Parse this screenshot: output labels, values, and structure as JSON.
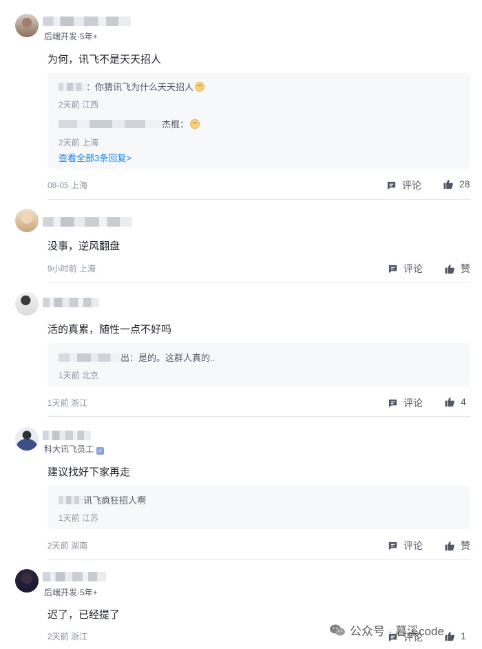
{
  "actions": {
    "comment_label": "评论",
    "like_label": "赞"
  },
  "comments": [
    {
      "badge": "后端开发·5年+",
      "content": "为何，讯飞不是天天招人",
      "replies": [
        {
          "author_tail": "：",
          "text": "你猜讯飞为什么天天招人",
          "meta": "2天前 江西"
        },
        {
          "author_tail": "杰棍：",
          "text": "",
          "meta": "2天前 上海"
        }
      ],
      "view_all": "查看全部3条回复>",
      "meta": "08-05 上海",
      "like_count": "28"
    },
    {
      "badge": "",
      "content": "没事，逆风翻盘",
      "meta": "9小时前 上海",
      "like_count": "赞"
    },
    {
      "badge": "",
      "content": "活的真累，随性一点不好吗",
      "replies": [
        {
          "author_tail": "出：",
          "text": "是的。这群人真的..",
          "meta": "1天前 北京"
        }
      ],
      "meta": "1天前 浙江",
      "like_count": "4"
    },
    {
      "badge": "科大讯飞员工",
      "content": "建议找好下家再走",
      "replies": [
        {
          "author_tail": "",
          "text": "讯飞疯狂招人啊",
          "meta": "1天前 江苏"
        }
      ],
      "meta": "2天前 湖南",
      "like_count": "赞"
    },
    {
      "badge": "后端开发·5年+",
      "content": "迟了，已经提了",
      "meta": "2天前 浙江",
      "like_count": "1"
    }
  ],
  "watermark": "公众号 · 暮溪code"
}
